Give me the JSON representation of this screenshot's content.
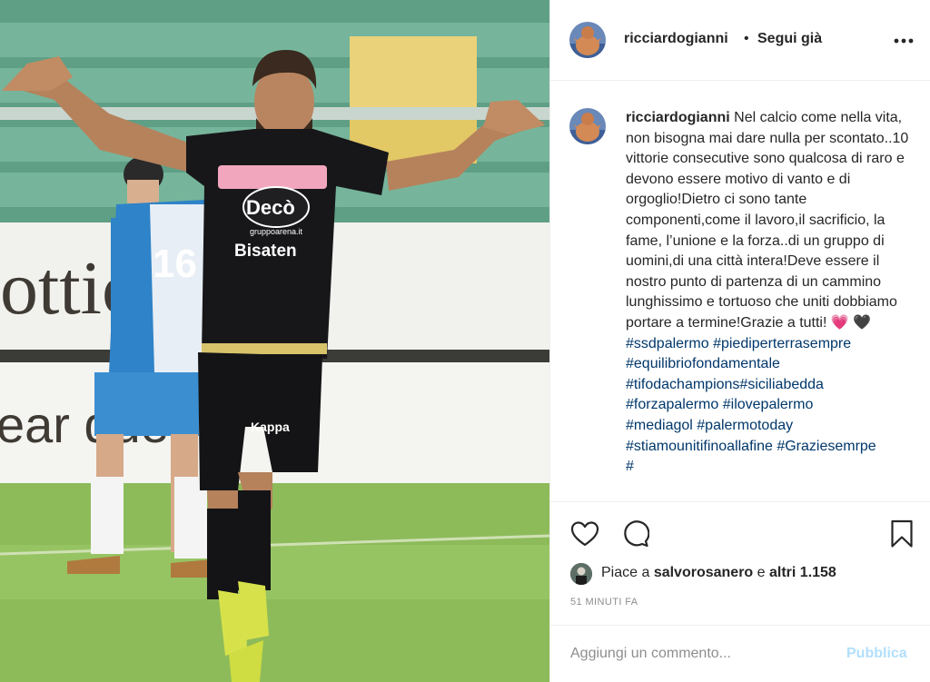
{
  "photo": {
    "banner_text_top": "ottic  ipar",
    "banner_text_bottom": "ear  que",
    "player_number": "16",
    "sponsor_top": "Decò",
    "sponsor_sub": "gruppoarena.it",
    "sponsor_main": "Bisaten",
    "shorts_logo": "Kappa"
  },
  "header": {
    "username": "ricciardogianni",
    "separator": "•",
    "follow_label": "Segui già",
    "more_icon": "more-horizontal-icon"
  },
  "caption": {
    "username": "ricciardogianni",
    "text": "Nel calcio come nella vita, non bisogna mai dare nulla per scontato..10 vittorie consecutive sono qualcosa di raro e devono essere motivo di vanto e di orgoglio!Dietro ci sono tante componenti,come il lavoro,il sacrificio, la fame, l’unione e la forza..di un gruppo di uomini,di una città intera!Deve essere il nostro punto di partenza di un cammino lunghissimo e tortuoso che uniti dobbiamo portare a termine!Grazie a tutti! ",
    "emoji_pink": "💗",
    "emoji_black": "🖤",
    "hashtags": [
      "#ssdpalermo",
      "#piediperterrasempre",
      "#equilibriofondamentale",
      "#tifodachampions",
      "#siciliabedda",
      "#forzapalermo",
      "#ilovepalermo",
      "#mediagol",
      "#palermotoday",
      "#stiamounitifinoallafine",
      "#Graziesemrpe",
      "#"
    ]
  },
  "actions": {
    "like_icon": "heart-icon",
    "comment_icon": "comment-icon",
    "save_icon": "bookmark-icon"
  },
  "likes": {
    "prefix": "Piace a ",
    "user": "salvorosanero",
    "middle": " e ",
    "others": "altri 1.158"
  },
  "timestamp": "51 MINUTI FA",
  "comment": {
    "placeholder": "Aggiungi un commento...",
    "post_label": "Pubblica"
  },
  "colors": {
    "text": "#262626",
    "hashtag": "#00376b",
    "muted": "#8e8e8e",
    "post_disabled": "#b2dffc"
  }
}
